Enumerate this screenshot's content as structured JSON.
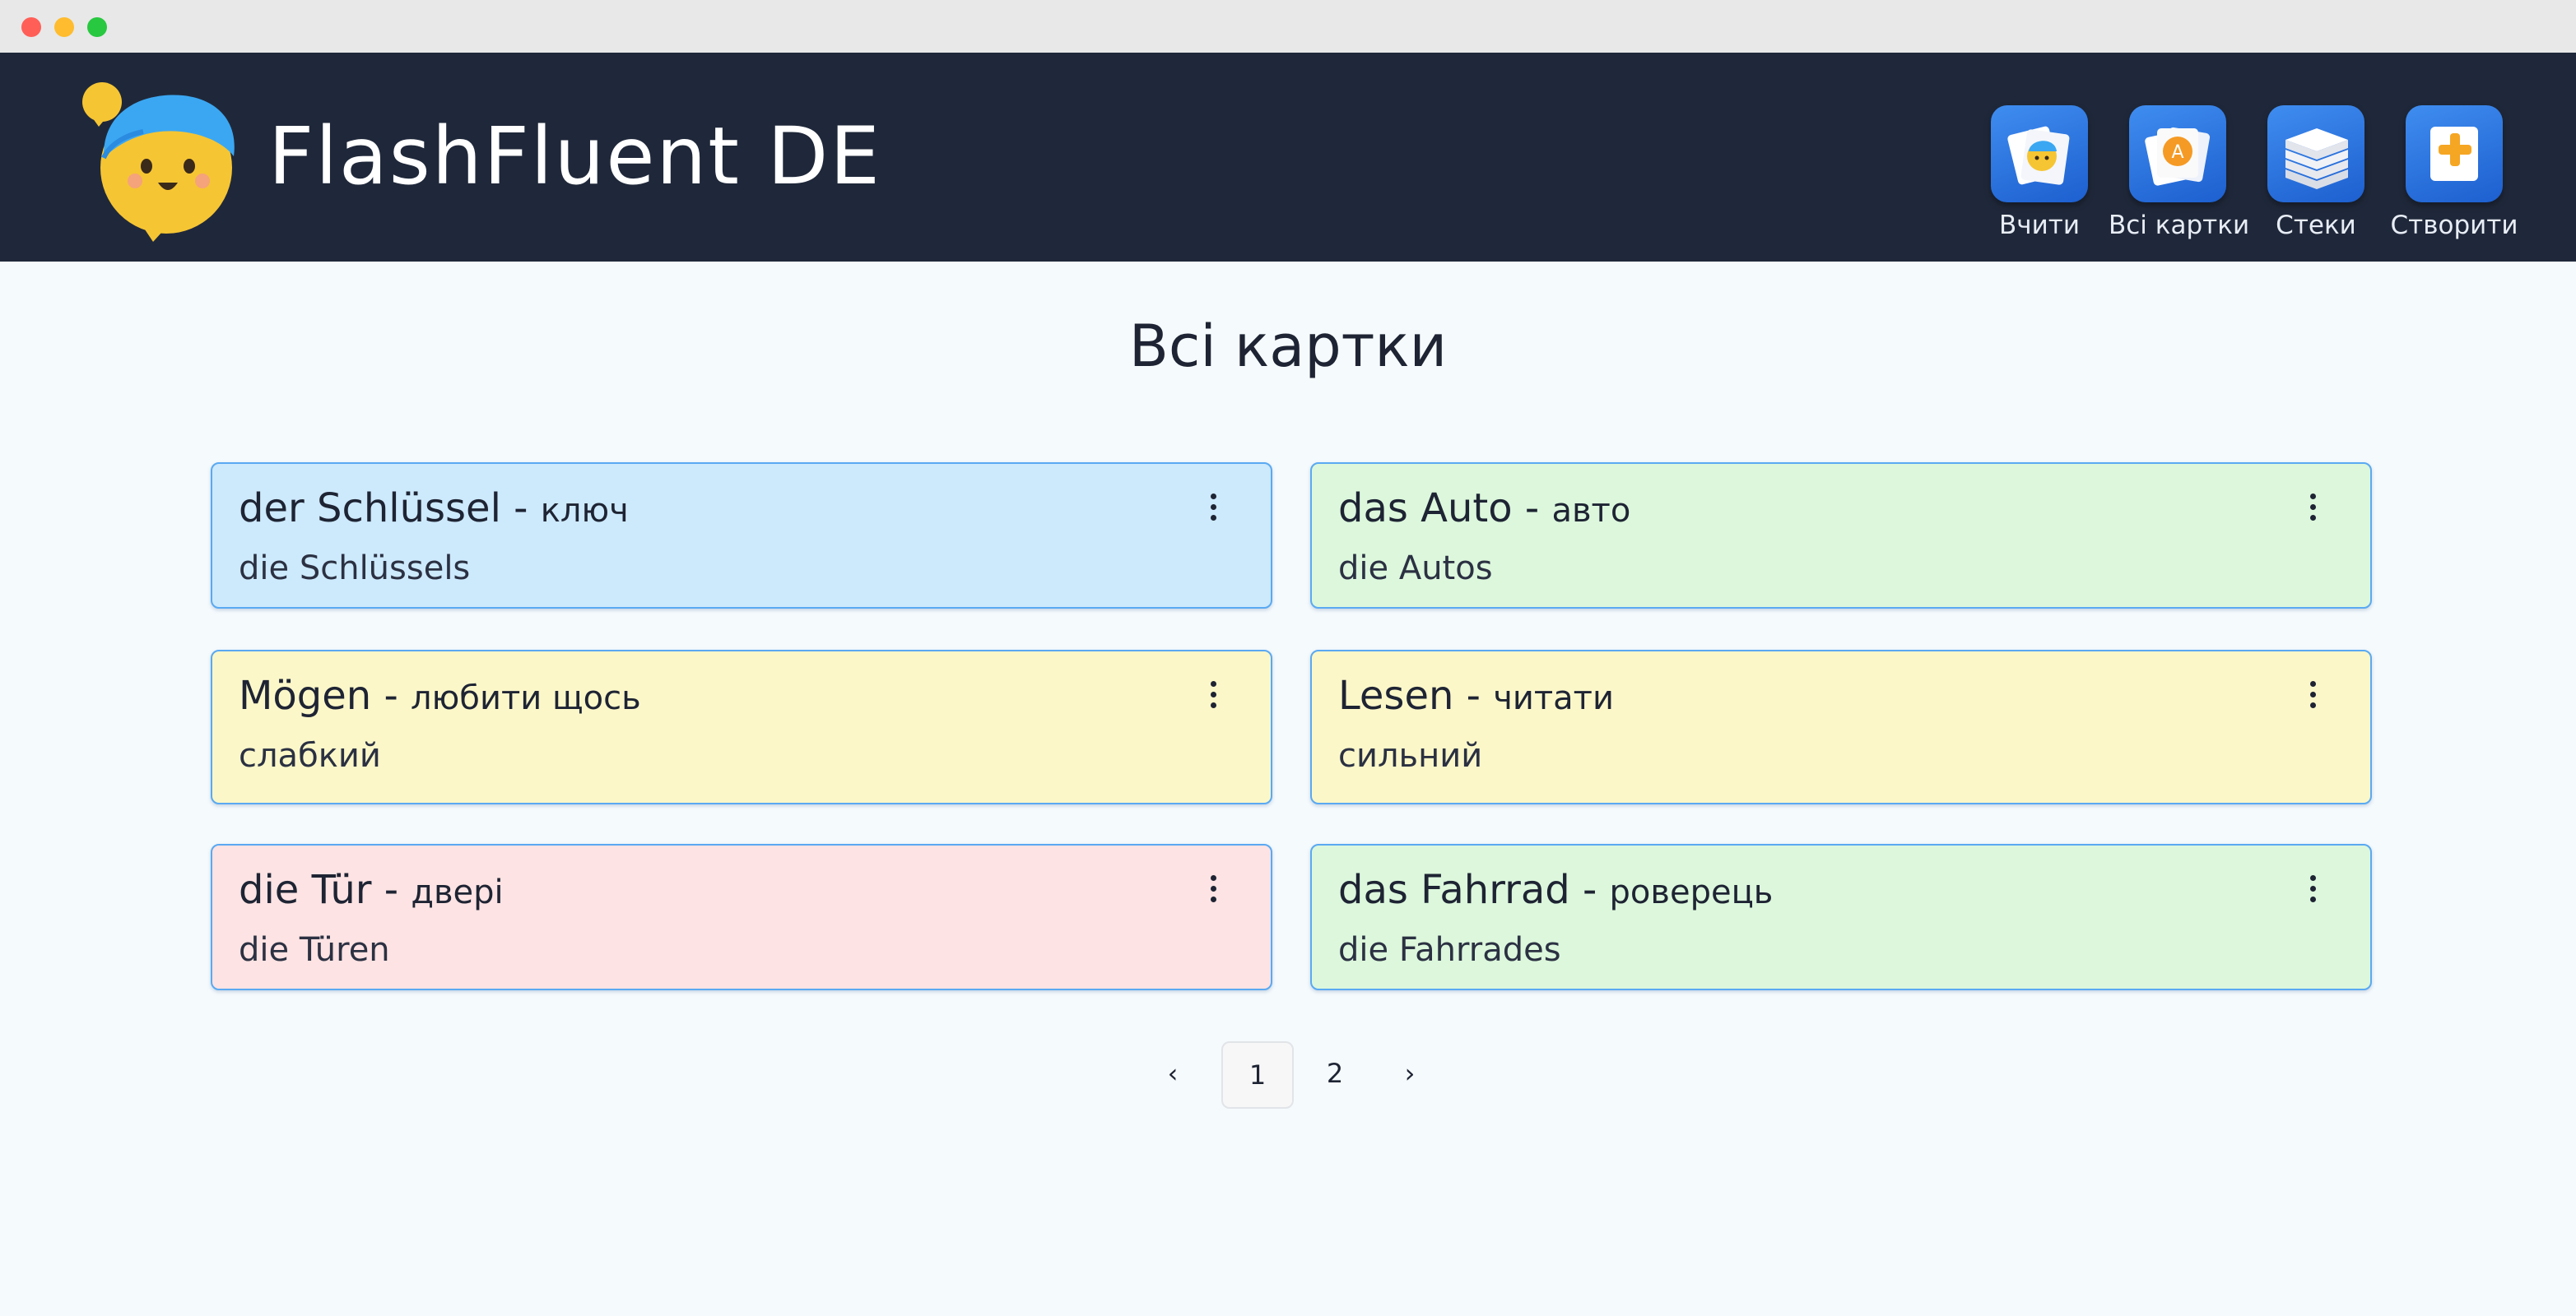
{
  "app": {
    "brand": "FlashFluent DE"
  },
  "nav": [
    {
      "label": "Вчити",
      "icon": "learn-cards-icon"
    },
    {
      "label": "Всі картки",
      "icon": "all-cards-icon"
    },
    {
      "label": "Стеки",
      "icon": "stacks-icon"
    },
    {
      "label": "Створити",
      "icon": "create-plus-icon"
    }
  ],
  "page": {
    "title": "Всі картки"
  },
  "cards": [
    {
      "word": "der Schlüssel - ",
      "translation": "ключ",
      "sub": "die Schlüssels",
      "color": "#cde9fc"
    },
    {
      "word": "das Auto - ",
      "translation": "авто",
      "sub": "die Autos",
      "color": "#dcf7dc"
    },
    {
      "word": "Mögen - ",
      "translation": "любити щось",
      "sub": "слабкий",
      "color": "#fbf7c9"
    },
    {
      "word": "Lesen - ",
      "translation": "читати",
      "sub": "сильний",
      "color": "#fbf7c9"
    },
    {
      "word": "die Tür - ",
      "translation": "двері",
      "sub": "die Türen",
      "color": "#fde3e3"
    },
    {
      "word": "das Fahrrad - ",
      "translation": "роверець",
      "sub": "die Fahrrades",
      "color": "#dcf7dc"
    }
  ],
  "pagination": {
    "prev": "‹",
    "pages": [
      "1",
      "2"
    ],
    "next": "›",
    "current": "1"
  },
  "colors": {
    "header": "#1f283a",
    "card_border": "#5aa9f2",
    "background": "#f5fafd"
  }
}
